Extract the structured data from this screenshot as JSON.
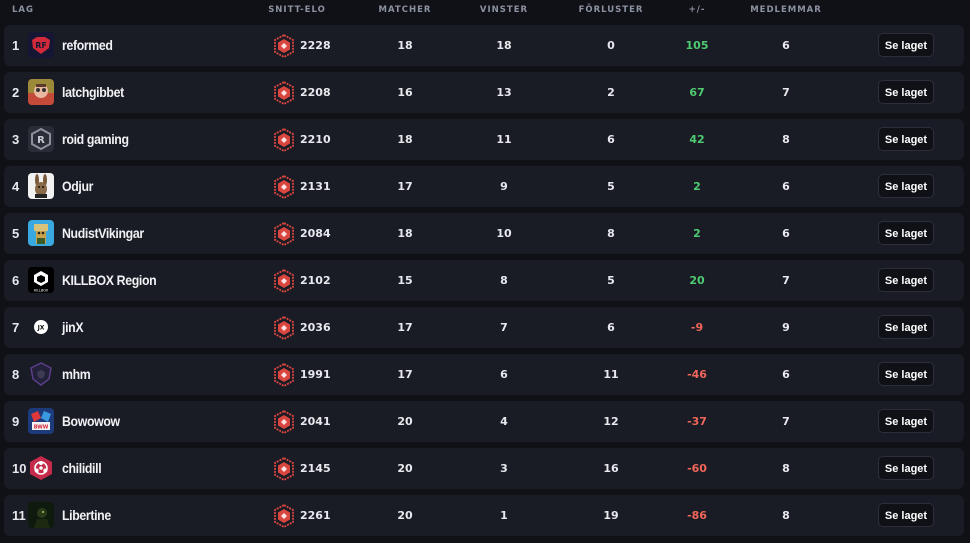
{
  "header": {
    "team": "LAG",
    "avg_elo": "SNITT-ELO",
    "matches": "MATCHER",
    "wins": "VINSTER",
    "losses": "FÖRLUSTER",
    "diff": "+/-",
    "members": "MEDLEMMAR"
  },
  "colors": {
    "background": "#0f1117",
    "row": "#1a1c25",
    "positive": "#4ecb71",
    "negative": "#f0665a",
    "elo_badge": "#d9463f"
  },
  "view_button_label": "Se laget",
  "rows": [
    {
      "rank": "1",
      "name": "reformed",
      "elo": "2228",
      "matches": "18",
      "wins": "18",
      "losses": "0",
      "diff": "105",
      "diff_sign": "pos",
      "members": "6",
      "avatar_icon": "reformed-logo-icon"
    },
    {
      "rank": "2",
      "name": "latchgibbet",
      "elo": "2208",
      "matches": "16",
      "wins": "13",
      "losses": "2",
      "diff": "67",
      "diff_sign": "pos",
      "members": "7",
      "avatar_icon": "latchgibbet-avatar-icon"
    },
    {
      "rank": "3",
      "name": "roid gaming",
      "elo": "2210",
      "matches": "18",
      "wins": "11",
      "losses": "6",
      "diff": "42",
      "diff_sign": "pos",
      "members": "8",
      "avatar_icon": "roid-gaming-logo-icon"
    },
    {
      "rank": "4",
      "name": "Odjur",
      "elo": "2131",
      "matches": "17",
      "wins": "9",
      "losses": "5",
      "diff": "2",
      "diff_sign": "pos",
      "members": "6",
      "avatar_icon": "odjur-rabbit-logo-icon"
    },
    {
      "rank": "5",
      "name": "NudistVikingar",
      "elo": "2084",
      "matches": "18",
      "wins": "10",
      "losses": "8",
      "diff": "2",
      "diff_sign": "pos",
      "members": "6",
      "avatar_icon": "nudistvikingar-avatar-icon"
    },
    {
      "rank": "6",
      "name": "KILLBOX Region",
      "elo": "2102",
      "matches": "15",
      "wins": "8",
      "losses": "5",
      "diff": "20",
      "diff_sign": "pos",
      "members": "7",
      "avatar_icon": "killbox-logo-icon"
    },
    {
      "rank": "7",
      "name": "jinX",
      "elo": "2036",
      "matches": "17",
      "wins": "7",
      "losses": "6",
      "diff": "-9",
      "diff_sign": "neg",
      "members": "9",
      "avatar_icon": "jinx-logo-icon"
    },
    {
      "rank": "8",
      "name": "mhm",
      "elo": "1991",
      "matches": "17",
      "wins": "6",
      "losses": "11",
      "diff": "-46",
      "diff_sign": "neg",
      "members": "6",
      "avatar_icon": "mhm-shield-logo-icon"
    },
    {
      "rank": "9",
      "name": "Bowowow",
      "elo": "2041",
      "matches": "20",
      "wins": "4",
      "losses": "12",
      "diff": "-37",
      "diff_sign": "neg",
      "members": "7",
      "avatar_icon": "bowowow-logo-icon"
    },
    {
      "rank": "10",
      "name": "chilidill",
      "elo": "2145",
      "matches": "20",
      "wins": "3",
      "losses": "16",
      "diff": "-60",
      "diff_sign": "neg",
      "members": "8",
      "avatar_icon": "chilidill-biohazard-logo-icon"
    },
    {
      "rank": "11",
      "name": "Libertine",
      "elo": "2261",
      "matches": "20",
      "wins": "1",
      "losses": "19",
      "diff": "-86",
      "diff_sign": "neg",
      "members": "8",
      "avatar_icon": "libertine-avatar-icon"
    }
  ]
}
